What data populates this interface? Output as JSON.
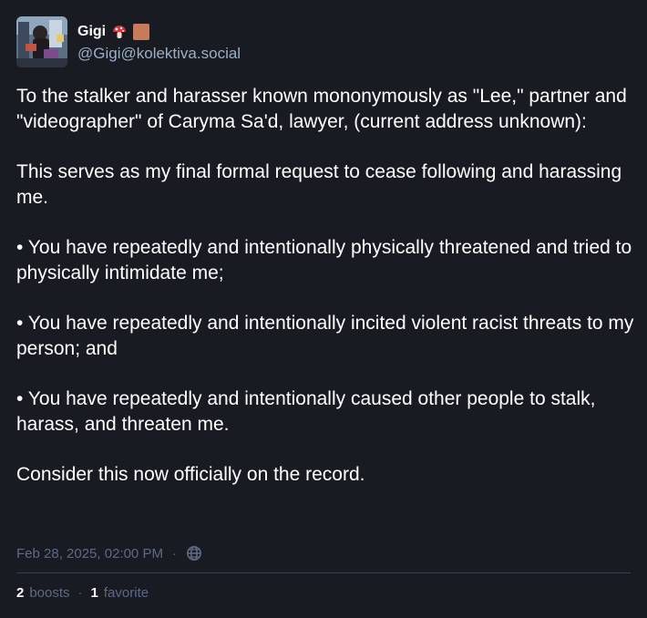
{
  "author": {
    "display_name": "Gigi",
    "handle": "@Gigi@kolektiva.social",
    "emoji_1": "mushroom-emoji",
    "emoji_2": "orange-square-emoji"
  },
  "content": {
    "paragraphs": [
      "To the stalker and harasser known mononymously as \"Lee,\" partner and \"videographer\" of Caryma Sa'd, lawyer, (current address unknown):",
      "This serves as my final formal request to cease following and harassing me.",
      "• You have repeatedly and intentionally physically threatened and tried to physically intimidate me;",
      "• You have repeatedly and intentionally incited violent racist threats to my person; and",
      "• You have repeatedly and intentionally caused other people to stalk, harass, and threaten me.",
      "Consider this now officially on the record."
    ]
  },
  "meta": {
    "timestamp": "Feb 28, 2025, 02:00 PM",
    "separator": "·",
    "visibility_icon": "globe-icon"
  },
  "stats": {
    "boosts_count": "2",
    "boosts_label": "boosts",
    "separator": "·",
    "favorites_count": "1",
    "favorites_label": "favorite"
  },
  "colors": {
    "background": "#191b22",
    "text": "#ffffff",
    "handle": "#9baec8",
    "muted": "#606984",
    "divider": "#393f4f"
  }
}
